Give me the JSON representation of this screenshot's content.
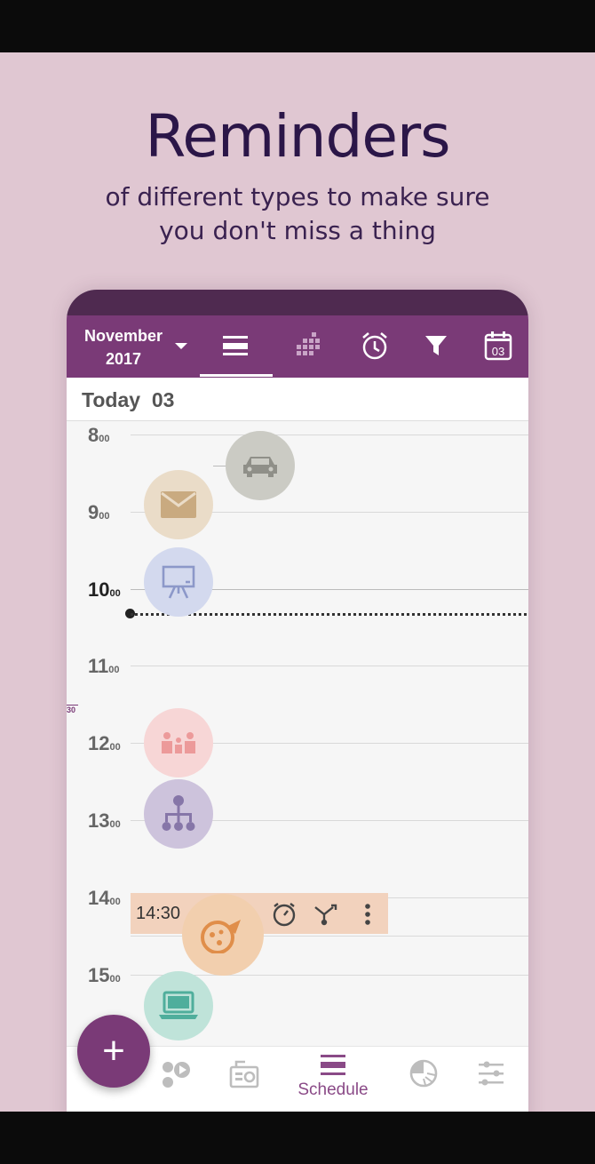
{
  "promo": {
    "headline": "Reminders",
    "subline1": "of different types to make sure",
    "subline2": "you don't miss a thing"
  },
  "toolbar": {
    "month": "November",
    "year": "2017",
    "icons": [
      "list-view-icon",
      "grid-view-icon",
      "alarm-icon",
      "filter-icon",
      "calendar-day-icon"
    ],
    "calendar_day": "03"
  },
  "today": {
    "label": "Today",
    "day": "03"
  },
  "hours": [
    {
      "h": "8",
      "m": "00"
    },
    {
      "h": "9",
      "m": "00"
    },
    {
      "h": "10",
      "m": "00"
    },
    {
      "h": "11",
      "m": "00"
    },
    {
      "h": "12",
      "m": "00"
    },
    {
      "h": "13",
      "m": "00"
    },
    {
      "h": "14",
      "m": "00"
    },
    {
      "h": "15",
      "m": "00"
    }
  ],
  "half_hour_mark": "30",
  "event": {
    "time": "14:30",
    "icons": [
      "alarm-icon",
      "branch-icon",
      "more-icon"
    ]
  },
  "bubbles": [
    "car-icon",
    "mail-icon",
    "presentation-icon",
    "people-icon",
    "hierarchy-icon",
    "pizza-icon",
    "laptop-icon"
  ],
  "colors": {
    "accent": "#7a3a77",
    "background": "#e0c7d2",
    "headline": "#2b1648"
  },
  "bottom_nav": {
    "items": [
      "bubbles-icon",
      "radio-icon",
      "schedule-icon",
      "pie-chart-icon",
      "settings-sliders-icon"
    ],
    "active_label": "Schedule"
  },
  "fab": {
    "label": "+"
  }
}
